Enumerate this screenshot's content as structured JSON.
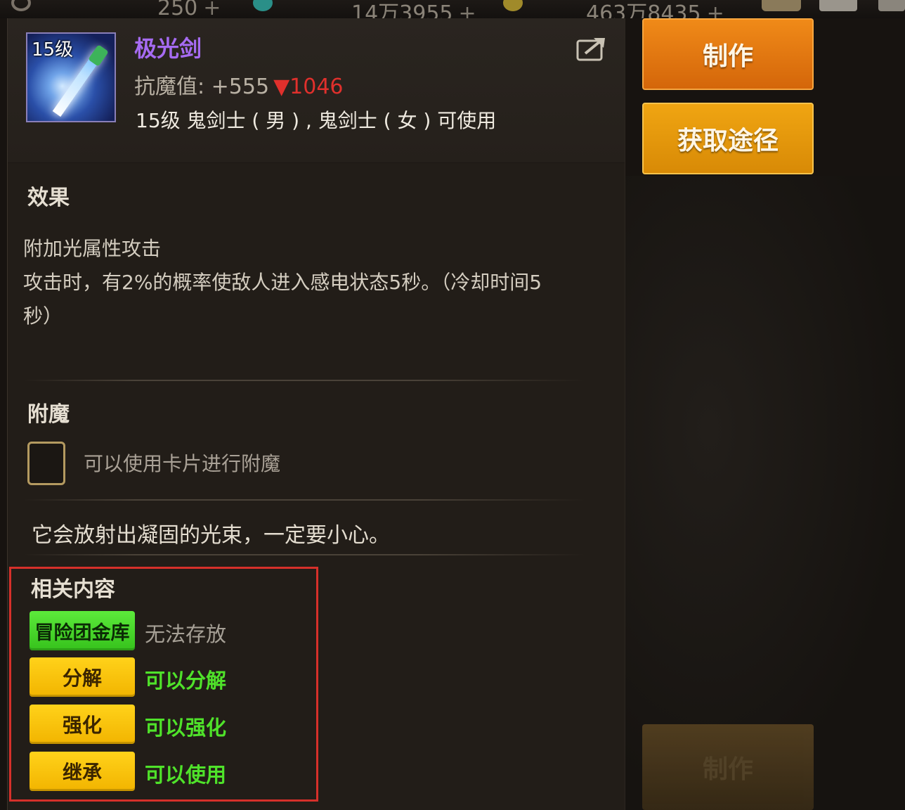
{
  "topbar": {
    "items": [
      {
        "value": "250",
        "plus": "+"
      },
      {
        "value": "14万3955",
        "plus": "+"
      },
      {
        "value": "463万8435",
        "plus": "+"
      }
    ]
  },
  "item": {
    "level_badge": "15级",
    "name": "极光剑",
    "stat_label": "抗魔值:",
    "stat_value": "+555",
    "stat_down_arrow": "▼",
    "stat_down_value": "1046",
    "usable_by": "15级 鬼剑士 ( 男 ) , 鬼剑士 ( 女 ) 可使用",
    "name_color": "#a66bf2"
  },
  "effect": {
    "title": "效果",
    "lines": [
      "附加光属性攻击",
      "攻击时，有2%的概率使敌人进入感电状态5秒。（冷却时间5",
      "秒）"
    ]
  },
  "enchant": {
    "title": "附魔",
    "card_text": "可以使用卡片进行附魔"
  },
  "flavor_text": "它会放射出凝固的光束，一定要小心。",
  "related": {
    "title": "相关内容",
    "rows": [
      {
        "tag": "冒险团金库",
        "desc": "无法存放"
      },
      {
        "tag": "分解",
        "desc": "可以分解"
      },
      {
        "tag": "强化",
        "desc": "可以强化"
      },
      {
        "tag": "继承",
        "desc": "可以使用"
      }
    ]
  },
  "buttons": {
    "make": "制作",
    "source": "获取途径",
    "make_bottom": "制作"
  },
  "colors": {
    "accent_orange": "#f08a18",
    "accent_gold": "#f0a512",
    "tag_yellow": "#ffd21a",
    "tag_green": "#5cea3b",
    "highlight_red": "#d6302a",
    "stat_down_red": "#e0302c"
  }
}
